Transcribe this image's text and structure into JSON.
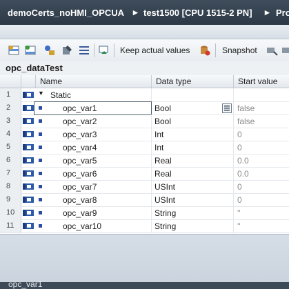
{
  "breadcrumb": {
    "project": "demoCerts_noHMI_OPCUA",
    "device": "test1500 [CPU 1515-2 PN]",
    "next": "Pro",
    "separator": "▸"
  },
  "toolbar": {
    "keep_actual_values": "Keep actual values",
    "snapshot": "Snapshot"
  },
  "block_name": "opc_dataTest",
  "table": {
    "headers": {
      "name": "Name",
      "data_type": "Data type",
      "start_value": "Start value"
    },
    "rows": [
      {
        "num": "1",
        "name": "Static",
        "type": "",
        "start": ""
      },
      {
        "num": "2",
        "name": "opc_var1",
        "type": "Bool",
        "start": "false"
      },
      {
        "num": "3",
        "name": "opc_var2",
        "type": "Bool",
        "start": "false"
      },
      {
        "num": "4",
        "name": "opc_var3",
        "type": "Int",
        "start": "0"
      },
      {
        "num": "5",
        "name": "opc_var4",
        "type": "Int",
        "start": "0"
      },
      {
        "num": "6",
        "name": "opc_var5",
        "type": "Real",
        "start": "0.0"
      },
      {
        "num": "7",
        "name": "opc_var6",
        "type": "Real",
        "start": "0.0"
      },
      {
        "num": "8",
        "name": "opc_var7",
        "type": "USInt",
        "start": "0"
      },
      {
        "num": "9",
        "name": "opc_var8",
        "type": "USInt",
        "start": "0"
      },
      {
        "num": "10",
        "name": "opc_var9",
        "type": "String",
        "start": "''"
      },
      {
        "num": "11",
        "name": "opc_var10",
        "type": "String",
        "start": "''"
      }
    ]
  },
  "status": {
    "text": "opc_var1"
  },
  "colors": {
    "title_bg": "#2c3845",
    "accent_blue": "#2b4ca0",
    "grid_border": "#c6cdd4"
  }
}
